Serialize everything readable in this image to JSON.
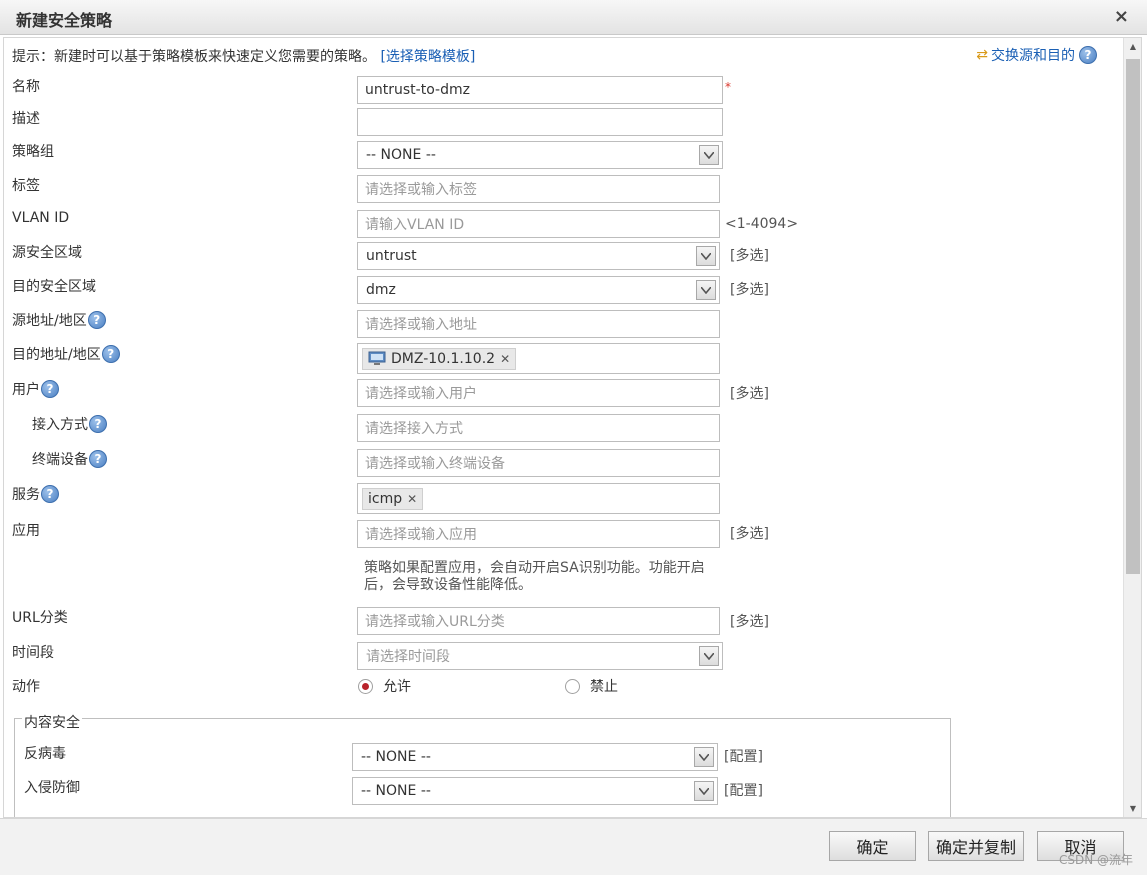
{
  "window": {
    "title": "新建安全策略",
    "close_symbol": "×"
  },
  "hint": {
    "text": "提示：新建时可以基于策略模板来快速定义您需要的策略。",
    "link": "[选择策略模板]"
  },
  "swap": {
    "label": "交换源和目的",
    "icon": "swap-arrows-icon"
  },
  "help_glyph": "?",
  "required_mark": "*",
  "dropdown_icon": "chevron-down-icon",
  "form": {
    "name": {
      "label": "名称",
      "value": "untrust-to-dmz"
    },
    "description": {
      "label": "描述",
      "value": ""
    },
    "policy_group": {
      "label": "策略组",
      "value": "-- NONE --"
    },
    "tag": {
      "label": "标签",
      "placeholder": "请选择或输入标签"
    },
    "vlan": {
      "label": "VLAN ID",
      "placeholder": "请输入VLAN ID",
      "range": "<1-4094>"
    },
    "src_zone": {
      "label": "源安全区域",
      "value": "untrust",
      "multi": "[多选]"
    },
    "dst_zone": {
      "label": "目的安全区域",
      "value": "dmz",
      "multi": "[多选]"
    },
    "src_addr": {
      "label": "源地址/地区",
      "placeholder": "请选择或输入地址"
    },
    "dst_addr": {
      "label": "目的地址/地区",
      "tag": "DMZ-10.1.10.2",
      "tag_icon": "computer-icon"
    },
    "user": {
      "label": "用户",
      "placeholder": "请选择或输入用户",
      "multi": "[多选]"
    },
    "access_mode": {
      "label": "接入方式",
      "placeholder": "请选择接入方式"
    },
    "terminal": {
      "label": "终端设备",
      "placeholder": "请选择或输入终端设备"
    },
    "service": {
      "label": "服务",
      "tag": "icmp"
    },
    "application": {
      "label": "应用",
      "placeholder": "请选择或输入应用",
      "multi": "[多选]",
      "note_line1": "策略如果配置应用，会自动开启SA识别功能。功能开启",
      "note_line2": "后，会导致设备性能降低。"
    },
    "url_category": {
      "label": "URL分类",
      "placeholder": "请选择或输入URL分类",
      "multi": "[多选]"
    },
    "time_range": {
      "label": "时间段",
      "placeholder": "请选择时间段"
    },
    "action": {
      "label": "动作",
      "options": [
        "允许",
        "禁止"
      ],
      "selected": "允许"
    }
  },
  "content_security": {
    "legend": "内容安全",
    "antivirus": {
      "label": "反病毒",
      "value": "-- NONE --",
      "config": "[配置]"
    },
    "ips": {
      "label": "入侵防御",
      "value": "-- NONE --",
      "config": "[配置]"
    }
  },
  "buttons": {
    "ok": "确定",
    "ok_copy": "确定并复制",
    "cancel": "取消"
  },
  "watermark": "CSDN @流年"
}
